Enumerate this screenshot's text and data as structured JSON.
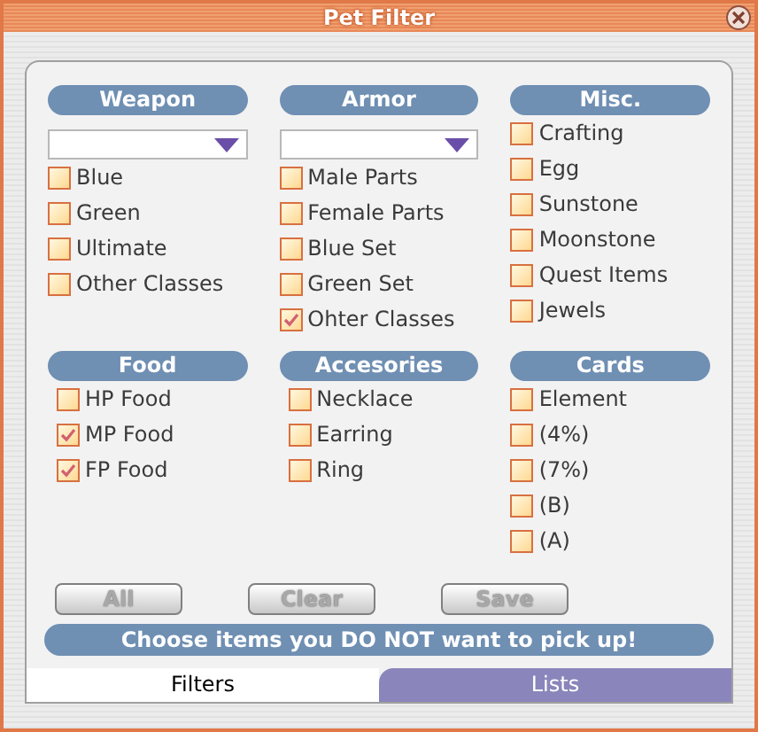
{
  "window": {
    "title": "Pet Filter"
  },
  "sections": [
    {
      "title": "Weapon",
      "kind": "dropdown",
      "items": [
        {
          "label": "Blue",
          "checked": false
        },
        {
          "label": "Green",
          "checked": false
        },
        {
          "label": "Ultimate",
          "checked": false
        },
        {
          "label": "Other Classes",
          "checked": false
        }
      ]
    },
    {
      "title": "Armor",
      "kind": "dropdown",
      "items": [
        {
          "label": "Male Parts",
          "checked": false
        },
        {
          "label": "Female Parts",
          "checked": false
        },
        {
          "label": "Blue Set",
          "checked": false
        },
        {
          "label": "Green Set",
          "checked": false
        },
        {
          "label": "Ohter Classes",
          "checked": true
        }
      ]
    },
    {
      "title": "Misc.",
      "kind": "plain",
      "items": [
        {
          "label": "Crafting",
          "checked": false
        },
        {
          "label": "Egg",
          "checked": false
        },
        {
          "label": "Sunstone",
          "checked": false
        },
        {
          "label": "Moonstone",
          "checked": false
        },
        {
          "label": "Quest Items",
          "checked": false
        },
        {
          "label": "Jewels",
          "checked": false
        }
      ]
    },
    {
      "title": "Food",
      "kind": "indented",
      "items": [
        {
          "label": "HP Food",
          "checked": false
        },
        {
          "label": "MP Food",
          "checked": true
        },
        {
          "label": "FP Food",
          "checked": true
        }
      ]
    },
    {
      "title": "Accesories",
      "kind": "indented",
      "items": [
        {
          "label": "Necklace",
          "checked": false
        },
        {
          "label": "Earring",
          "checked": false
        },
        {
          "label": "Ring",
          "checked": false
        }
      ]
    },
    {
      "title": "Cards",
      "kind": "plain",
      "items": [
        {
          "label": "Element",
          "checked": false
        },
        {
          "label": "(4%)",
          "checked": false
        },
        {
          "label": "(7%)",
          "checked": false
        },
        {
          "label": "(B)",
          "checked": false
        },
        {
          "label": "(A)",
          "checked": false
        }
      ]
    }
  ],
  "buttons": [
    "All",
    "Clear",
    "Save"
  ],
  "banner": "Choose items you DO NOT want to pick up!",
  "tabs": [
    {
      "label": "Filters",
      "selected": true
    },
    {
      "label": "Lists",
      "selected": false
    }
  ]
}
